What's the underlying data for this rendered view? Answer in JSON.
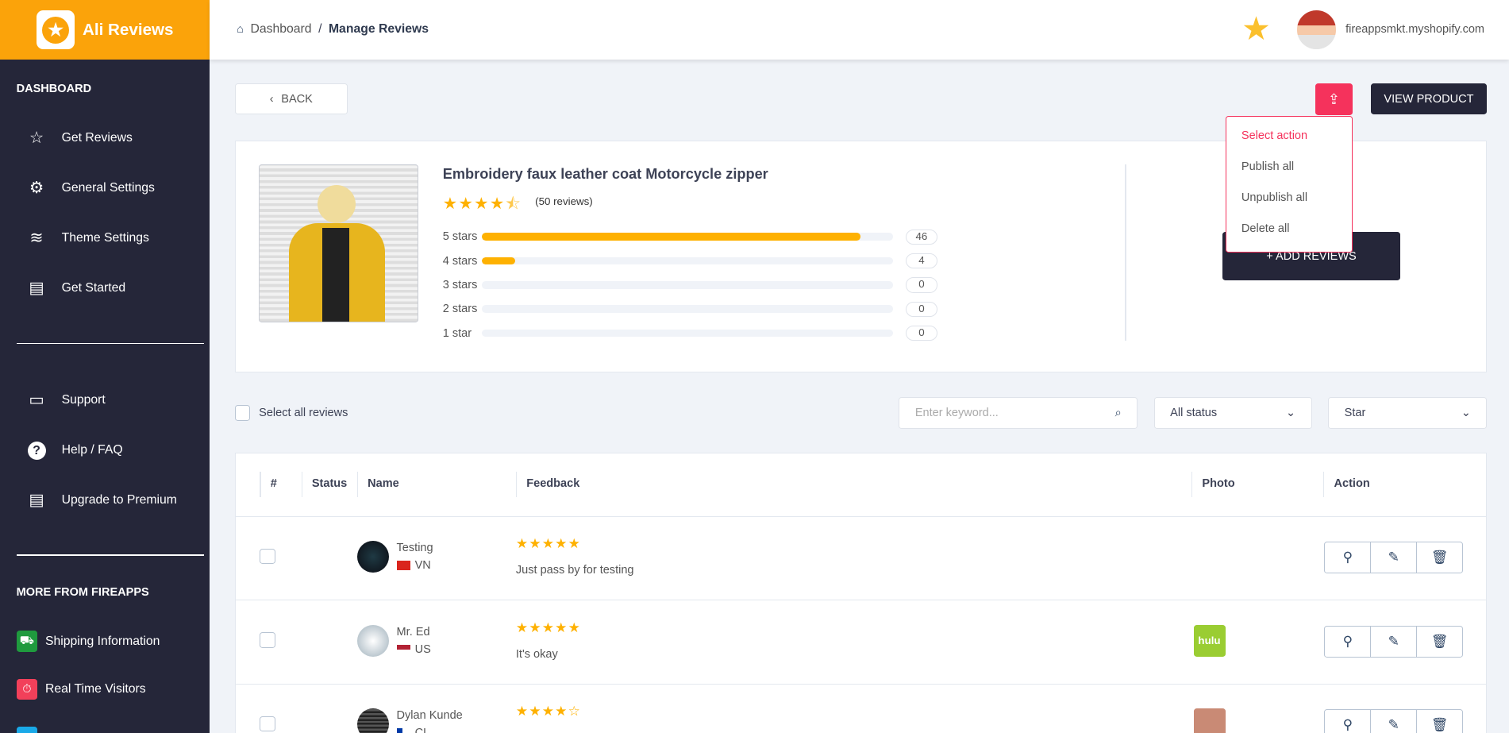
{
  "app": {
    "name": "Ali Reviews",
    "store": "fireappsmkt.myshopify.com"
  },
  "breadcrumb": {
    "home": "Dashboard",
    "sep": "/",
    "current": "Manage Reviews"
  },
  "sidebar": {
    "section1": "DASHBOARD",
    "items": [
      {
        "label": "Get Reviews",
        "icon": "star-outline-icon"
      },
      {
        "label": "General Settings",
        "icon": "gear-icon"
      },
      {
        "label": "Theme Settings",
        "icon": "layers-icon"
      },
      {
        "label": "Get Started",
        "icon": "document-icon"
      }
    ],
    "items2": [
      {
        "label": "Support",
        "icon": "chat-icon"
      },
      {
        "label": "Help / FAQ",
        "icon": "question-icon"
      },
      {
        "label": "Upgrade to Premium",
        "icon": "document-icon"
      }
    ],
    "section2": "MORE FROM FIREAPPS",
    "apps": [
      {
        "label": "Shipping Information",
        "color": "#1f9a3e"
      },
      {
        "label": "Real Time Visitors",
        "color": "#f2405a"
      }
    ]
  },
  "toolbar": {
    "back": "BACK",
    "view_product": "VIEW PRODUCT",
    "add_reviews": "+ ADD REVIEWS"
  },
  "action_menu": {
    "items": [
      "Select action",
      "Publish all",
      "Unpublish all",
      "Delete all"
    ]
  },
  "product": {
    "title": "Embroidery faux leather coat Motorcycle zipper",
    "rating": 4.5,
    "review_count": "(50 reviews)",
    "breakdown": [
      {
        "label": "5 stars",
        "count": "46",
        "fraction": 0.92
      },
      {
        "label": "4 stars",
        "count": "4",
        "fraction": 0.08
      },
      {
        "label": "3 stars",
        "count": "0",
        "fraction": 0
      },
      {
        "label": "2 stars",
        "count": "0",
        "fraction": 0
      },
      {
        "label": "1 star",
        "count": "0",
        "fraction": 0
      }
    ]
  },
  "filters": {
    "select_all": "Select all reviews",
    "search_placeholder": "Enter keyword...",
    "status": "All status",
    "star": "Star"
  },
  "table": {
    "headers": [
      "#",
      "Status",
      "Name",
      "Feedback",
      "Photo",
      "Action"
    ],
    "rows": [
      {
        "name": "Testing",
        "country": "VN",
        "stars": "★★★★★",
        "feedback": "Just pass by for testing",
        "published": false,
        "photo": ""
      },
      {
        "name": "Mr. Ed",
        "country": "US",
        "stars": "★★★★★",
        "feedback": "It's okay",
        "published": true,
        "photo": "hulu"
      },
      {
        "name": "Dylan Kunde",
        "country": "CL",
        "stars": "★★★★☆",
        "feedback": "",
        "published": true,
        "photo": ""
      }
    ]
  }
}
